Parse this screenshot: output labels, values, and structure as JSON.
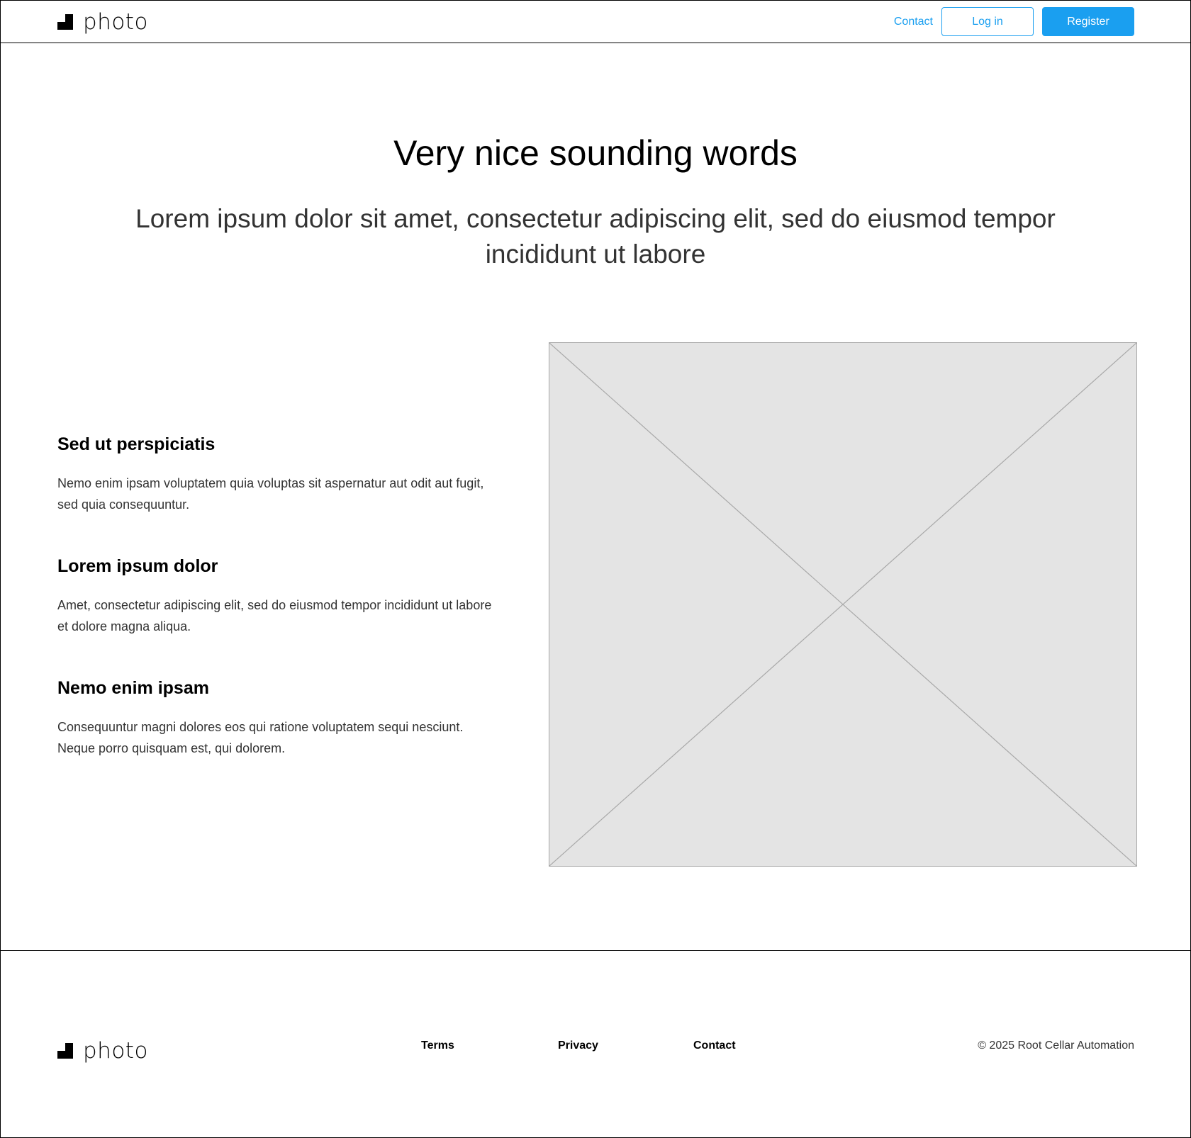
{
  "brand": {
    "name": "photo"
  },
  "header": {
    "nav_contact": "Contact",
    "login_label": "Log in",
    "register_label": "Register"
  },
  "hero": {
    "title": "Very nice sounding words",
    "subtitle": "Lorem ipsum dolor sit amet, consectetur adipiscing elit, sed do eiusmod tempor incididunt ut labore"
  },
  "features": [
    {
      "title": "Sed ut perspiciatis",
      "body": "Nemo enim ipsam voluptatem quia voluptas sit aspernatur aut odit aut fugit, sed quia consequuntur."
    },
    {
      "title": "Lorem ipsum dolor",
      "body": "Amet, consectetur adipiscing elit, sed do eiusmod tempor incididunt ut labore et dolore magna aliqua."
    },
    {
      "title": "Nemo enim ipsam",
      "body": "Consequuntur magni dolores eos qui ratione voluptatem sequi nesciunt. Neque porro quisquam est, qui dolorem."
    }
  ],
  "footer": {
    "links": [
      "Terms",
      "Privacy",
      "Contact"
    ],
    "copyright": "© 2025 Root Cellar Automation"
  },
  "colors": {
    "accent": "#1a9ff0",
    "placeholder_fill": "#e4e4e4",
    "placeholder_stroke": "#a8a8a8"
  },
  "icons": {
    "logo": "logo-mark-icon",
    "image_placeholder": "image-placeholder-icon"
  }
}
